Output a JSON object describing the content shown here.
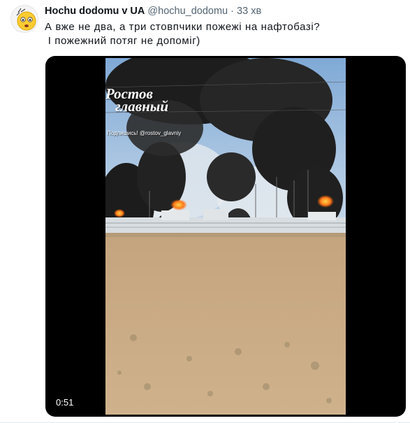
{
  "tweet": {
    "display_name": "Hochu dodomu v UA",
    "handle": "@hochu_dodomu",
    "separator": "·",
    "time": "33 хв",
    "text_line1": "А вже не два, а три стовпчики пожежі на нафтобазі?",
    "text_line2": " І пожежний потяг не допоміг)"
  },
  "video": {
    "duration": "0:51",
    "watermark_line1": "Ростов",
    "watermark_line2": "главный",
    "watermark_sub": "Подпишись! @rostov_glavniy"
  },
  "icons": {
    "avatar": "emoji-face-avatar"
  }
}
